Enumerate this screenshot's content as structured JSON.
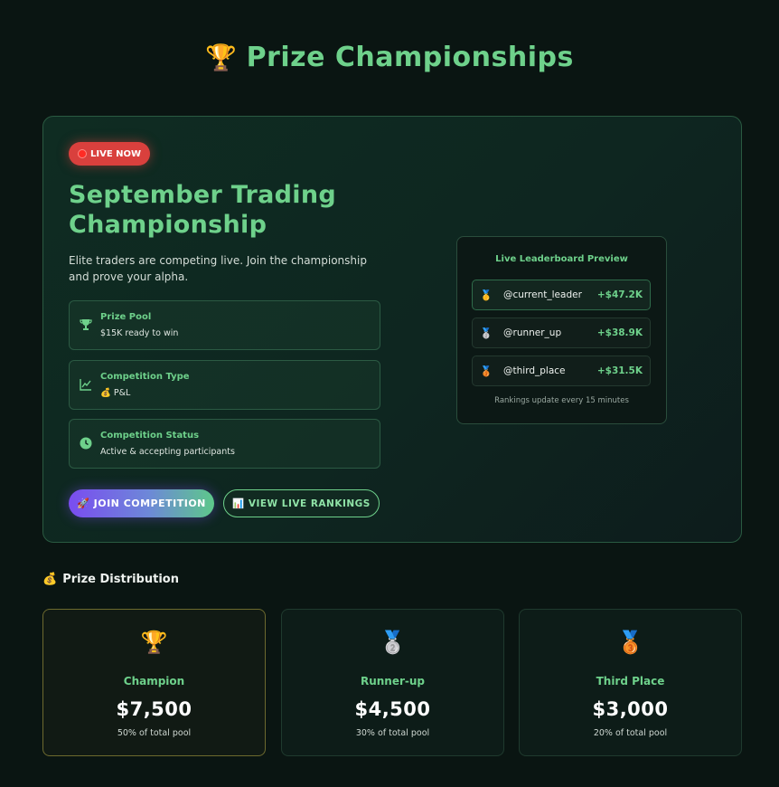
{
  "page": {
    "title": "Prize Championships",
    "title_icon": "trophy-icon"
  },
  "hero": {
    "badge": "LIVE NOW",
    "title": "September Trading Championship",
    "description": "Elite traders are competing live. Join the championship and prove your alpha.",
    "info_cards": [
      {
        "icon": "trophy-icon",
        "label": "Prize Pool",
        "value": "$15K ready to win"
      },
      {
        "icon": "line-chart-icon",
        "label": "Competition Type",
        "value": "💰 P&L"
      },
      {
        "icon": "clock-icon",
        "label": "Competition Status",
        "value": "Active & accepting participants"
      }
    ],
    "join_button": "🚀 JOIN COMPETITION",
    "view_button": "📊 VIEW LIVE RANKINGS"
  },
  "leaderboard": {
    "title": "Live Leaderboard Preview",
    "rows": [
      {
        "medal": "🥇",
        "user": "@current_leader",
        "pnl": "+$47.2K"
      },
      {
        "medal": "🥈",
        "user": "@runner_up",
        "pnl": "+$38.9K"
      },
      {
        "medal": "🥉",
        "user": "@third_place",
        "pnl": "+$31.5K"
      }
    ],
    "note": "Rankings update every 15 minutes"
  },
  "distribution": {
    "title": "Prize Distribution",
    "title_icon": "💰",
    "prizes": [
      {
        "icon": "🏆",
        "place": "Champion",
        "amount": "$7,500",
        "share": "50% of total pool"
      },
      {
        "icon": "🥈",
        "place": "Runner-up",
        "amount": "$4,500",
        "share": "30% of total pool"
      },
      {
        "icon": "🥉",
        "place": "Third Place",
        "amount": "$3,000",
        "share": "20% of total pool"
      }
    ]
  },
  "colors": {
    "accent": "#6ed18b",
    "background": "#0a1512",
    "live": "#d9403d",
    "gold_border": "#6d6a2e"
  }
}
